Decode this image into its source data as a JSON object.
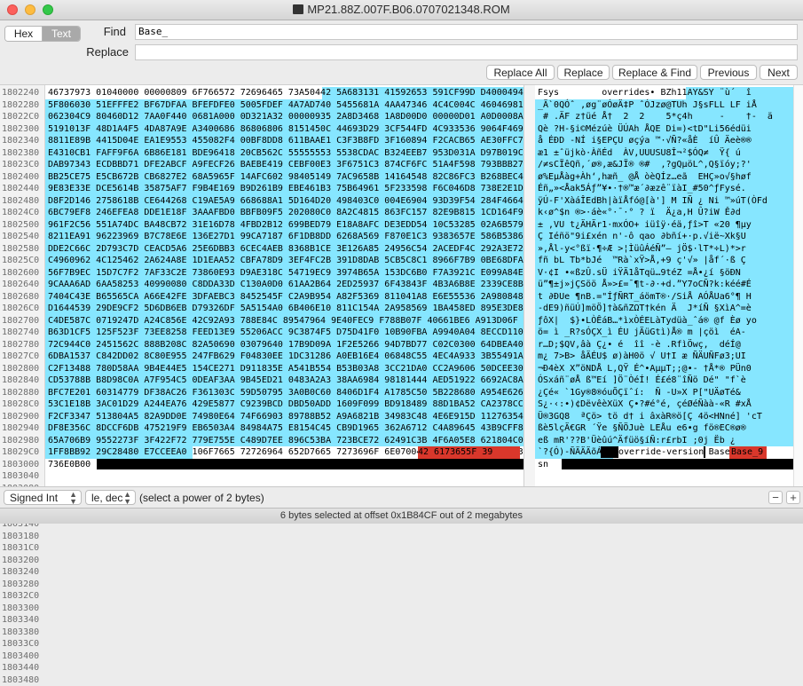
{
  "window": {
    "title": "MP21.88Z.007F.B06.0707021348.ROM",
    "file_icon": "document-icon"
  },
  "toolbar": {
    "mode_hex": "Hex",
    "mode_text": "Text",
    "find_label": "Find",
    "find_value": "Base_",
    "replace_label": "Replace",
    "replace_value": "",
    "buttons": {
      "replace_all": "Replace All",
      "replace": "Replace",
      "replace_find": "Replace & Find",
      "previous": "Previous",
      "next": "Next"
    }
  },
  "editor": {
    "offsets": [
      "1802240",
      "1802280",
      "18022C0",
      "1802300",
      "1802340",
      "1802380",
      "18023C0",
      "1802400",
      "1802440",
      "1802480",
      "18024C0",
      "1802500",
      "1802540",
      "1802580",
      "18025C0",
      "1802600",
      "1802640",
      "1802680",
      "18026C0",
      "1802700",
      "1802740",
      "1802780",
      "18027C0",
      "1802800",
      "1802840",
      "1802880",
      "18028C0",
      "1802900",
      "1802940",
      "1802980",
      "18029C0",
      "1803000",
      "1803040",
      "1803080",
      "18030C0",
      "1803100",
      "1803140",
      "1803180",
      "18031C0",
      "1803200",
      "1803240",
      "1803280",
      "18032C0",
      "1803300",
      "1803340",
      "1803380",
      "18033C0",
      "1803400",
      "1803440",
      "1803480"
    ],
    "hex_rows": [
      "46737973 01040000 00000809 6F766572 72696465 73A50442 5A683131 41592653 591CF99D D4000494",
      "5F806030 51EFFFE2 BF67DFAA BFEFDFE0 5005FDEF 4A7AD740 5455681A 4AA47346 4C4C004C 46046981",
      "062304C9 80460D12 7AA0F440 0681A000 0D321A32 00000935 2A8D3468 1A8D00D0 00000D01 A0D0008A",
      "5191013F 48D1A4F5 4DA87A9E A3400686 86806806 8151450C 44693D29 3CF544FD 4C933536 9064F469",
      "8811E89B 4415D04E EA1E9553 455082F4 00BF8DD8 611BAAE1 C3F3B8FD 3F160894 F2CACB65 AE30FFC7",
      "E4310CB1 FAFF9F6A 6B86E181 BDE96418 20CB562C 55555553 5538CDAC B324EEB7 953D031A D97B019C",
      "DAB97343 ECDBBD71 DFE2ABCF A9FECF26 BAEBE419 CEBF00E3 3F6751C3 874CF6FC 51A4F598 793BBB27",
      "BB25CE75 E5CB672B CB6827E2 68A5965F 14AFC602 98405149 7AC9658B 14164548 82C86FC3 B268BEC4",
      "9E83E33E DCE5614B 35875AF7 F9B4E169 B9D261B9 EBE461B3 75B64961 5F233598 F6C046D8 738E2E1D",
      "D8F2D146 2758618B CE644268 C19AE5A9 668688A1 5D164D20 498403C0 004E6904 93D39F54 284F4664",
      "6BC79EF8 246EFEA8 DDE1E18F 3AAAFBD0 BBFB09F5 202080C0 8A2C4815 863FC157 82E9B815 1CD164F9",
      "961F2C56 551A74DC BA48CB72 31E16D78 4FBD2B12 699BED79 E18A8AFC DE3EDD54 10C53285 02A6B579",
      "8211EA91 96223969 B7C78E6E 136E27D1 99CA7187 6F1DB8DD 6268A569 F870E1C3 9383657E 586B5386",
      "DDE2C66C 2D793C7D CEACD5A6 25E6DBB3 6CEC4AEB 8368B1CE 3E126A85 24956C54 2ACEDF4C 292A3E72",
      "C4960962 4C125462 2A624A8E 1D1EAA52 CBFA78D9 3EF4FC2B 391D8DAB 5CB5C8C1 8966F7B9 0BE68DFA",
      "56F7B9EC 15D7C7F2 7AF33C2E 73860E93 D9AE318C 54719EC9 3974B65A 153DC6B0 F7A3921C E099A84E",
      "9CAAA6AD 6AA58253 40990080 C8DDA33D C130A0D0 61AA2B64 2ED25937 6F43843F 4B3A6B8E 2339CE8B",
      "7404C43E B65565CA A66E42FE 3DFAEBC3 8452545F C2A9B954 A82F5369 811041A8 E6E55536 2A980848",
      "D1644539 29DE9CF2 5D6DB6EB D79326DF 5A5154A0 6B406E10 811C154A 2A958569 1BA458ED 895E3DE8",
      "C4DE587C 0719247D A24C856E 42C92A93 788E84C 89547964 9E40FEC9 F788B07F 40661BE6 A913D06F",
      "B63D1CF5 125F523F 73EE8258 FEED13E9 55206ACC 9C3874F5 D75D41F0 10B90FBA A9940A04 8ECCD110",
      "72C944C0 2451562C 888B208C 82A50690 03079640 17B9D09A 1F2E5266 94D7BD77 C02C0300 64DBEA40",
      "6DBA1537 C842DD02 8C80E955 247FB629 F04830EE 1DC31286 A0EB16E4 06848C55 4EC4A933 3B55491A",
      "C2F13488 780D58AA 9B4E44E5 154CE271 D911835E A541B554 B53B03A8 3CC21DA0 CC2A9606 50DCEE30",
      "CD53788B B8D98C0A A7F954C5 0DEAF3AA 9B45ED21 0483A2A3 38AA6984 98181444 AED51922 6692AC8A",
      "BFC7E201 60314779 DF38AC26 F361303C 59D50795 3A0B0C60 8406D1F4 A1785C50 5B228680 A954E626",
      "53C1E18B 3AC01D29 A244EA76 429E5877 C9239BCD DBD50ADD 1609F099 BD918489 88D1BA52 CA2378CC",
      "F2CF3347 513804A5 82A9DD0E 74980E64 74F66903 89788B52 A9A6821B 34983C48 4E6E915D 11276354",
      "DF8E356C 8DCCF6DB 475219F9 EB6503A4 84984A75 E8154C45 CB9D1965 362A6712 C4A89645 43B9CFF8",
      "65A706B9 9552273F 3F422F72 779E755E C489D7EE 896C53BA 723BCE72 62491C3B 4F6A05E8 621804C0",
      "1FF8BB92 29C28480 E7CCEEA0 106F7665 72726964 652D7665 7273696F 6E070042 6173655F 39000373",
      "736E0B00"
    ],
    "text_rows": [
      "Fsys        overrides• BZh11AY&SY ¨ù´  î",
      "_Ä`0QÓˆ ,øg¨øÓøÄ‡P ˆÓJzø@TUh J§sFLL LF iÅ",
      " # .ÄF z†üé Å†  2  2    5*ç4h     -    †-  ä",
      "Qè ?H-§i©Mézúè ÜÚAh ÅQE Di=)<tD\"Li56édüi",
      "å ÉÐD -NÍ i§EPÇU øçýa ™·√Ñ?«åÈ  íÛ Äeè®®",
      "æ1 ±ˆüjkò·ÀñÉd  ÀV,UUUSU8Î¬²$ÓQ≠  Ÿ{ ú",
      "/≠sCÏêQñ,´ø®,æ&JÏ® ®#  ,?gQµöL^,Q§ïóy;?'",
      "ø%EµÅàg+Àh‘,hæñ_ @Å òèQÍz…eã  EHÇ»o√§høf",
      "Éñ„»<Åak5Áƒ”¥•·†®™æ´∂æzê¨ïàI_#50^ƒFysé.",
      "ÿÚ-F'XàáÎEdBh|àïÅfó@[à'] M IÑ ¿ Ni ™»úT(ÒFd",
      "k‹ø^$n ®>·áè«°·¯·° ? ï  Ä¿a,H Û?iW Ê∂d",
      "± ,VU t¿ÄHÄr1·mxÓO+ iüîÿ·éä,ƒî>T «20 ¶µy",
      "Ç Iéñö\"9i£xén n'-ô qao ∂bñí+·p.√ië~Xk§U",
      "»,Ål-y<°ßï·¶÷Æ >¦ÌüûÁéÑ”– jÖ$·lT*÷L)*>r",
      "fñ bL Tb*bJé  ™Rà`xŸ>Å,+9 ç'√» |åf´·ß Ç",
      "V·¢I •«ßzÛ.sÜ iŸÄ1åTqü…9téZ =Å•¿í §öÐN",
      "ü”¶±j»jÇSöö Å»>£=¯¶t-∂·+d.”Y7oCÑ?k:kéé#É",
      "t ∂ÐUe ¶nB.=\"ÍƒÑRT_áömT®·/SiÅ AÓÅUa6°¶ H",
      "-dE9)ñüÚ]möÖ]†à&ñZΩT†kén Ä  J*íÑ §XìA^=è",
      "ƒôX|  $}•LÒÊáB…*ìxÒÉELàTydüà_ˆá® @f Èø yo",
      "ö= ì _R?sÓÇX_ì ÉU jÄüGtì)Å® m |çöì  éA-",
      "r…D;$QV,âà Ç¿• é  îî -è .RfìÖwç,  déÍ@",
      "m¿ 7>B> åÄÉU$ ø)àH0ö √ U†I æ ÑÄUÑFø3;UI",
      "¬Ð4èX X”öNDÅ L,QŸ É^•AµµT;;@•- †Å*® PÜn0",
      "ÓSxáñ¨øÅ ß™Eí ]Ö¨ÒéÍ! É£é8¨îÑö Dé\" \"f`è",
      "¿Çé« `1Gy®8®óuÕÇïˆí:  Ñ -U»X P[\"UÄøTé&",
      "S¿·‹:•)¢DëvêèXüX Ç•?#é°é, çéØéÑàà-«R #xÅ",
      "Ü®3GQ8  ªÇö> tö d† i âxàR®ö[Ç 4ö<HNné] 'cT",
      "ßè5lçÄ€GR ´Ÿe §ÑÖJuè LEÅu e6•g fö®EC®ø®",
      "eß mR'??B'Üèûú^Äfüö§íÑ:r£rbI ;0j Ëb ¿",
      "`?{Ó)-ÑÄÄÄõÁø® override-version Base_9  s",
      "sn"
    ],
    "selection_hex": "42 6173655F 39",
    "selection_text": "Base_9"
  },
  "bottom": {
    "type_select": "Signed Int",
    "endian_select": "le, dec",
    "hint": "(select a power of 2 bytes)",
    "minus_label": "−",
    "plus_label": "+"
  },
  "status": "6 bytes selected at offset 0x1B84CF out of 2 megabytes"
}
